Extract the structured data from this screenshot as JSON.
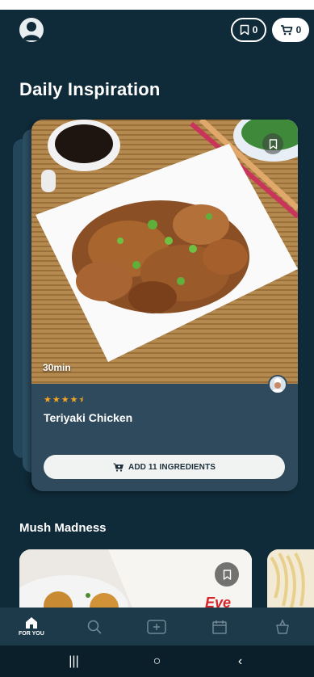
{
  "header": {
    "saved_count": "0",
    "cart_count": "0"
  },
  "daily": {
    "title": "Daily Inspiration",
    "card": {
      "time": "30min",
      "rating": 4.5,
      "rating_max": 5,
      "name": "Teriyaki Chicken",
      "button_label": "ADD 11 INGREDIENTS"
    }
  },
  "section2": {
    "title": "Mush Madness",
    "tile_text": "Eve"
  },
  "nav": {
    "items": [
      {
        "label": "FOR YOU",
        "icon": "home-icon"
      },
      {
        "label": "",
        "icon": "search-icon"
      },
      {
        "label": "",
        "icon": "add-icon"
      },
      {
        "label": "",
        "icon": "calendar-icon"
      },
      {
        "label": "",
        "icon": "basket-icon"
      }
    ]
  },
  "system_nav": {
    "recents": "|||",
    "home": "○",
    "back": "‹"
  },
  "colors": {
    "background": "#0f2a38",
    "card": "#2e4a5c",
    "star": "#f5a623",
    "nav": "#1d3a4b"
  }
}
